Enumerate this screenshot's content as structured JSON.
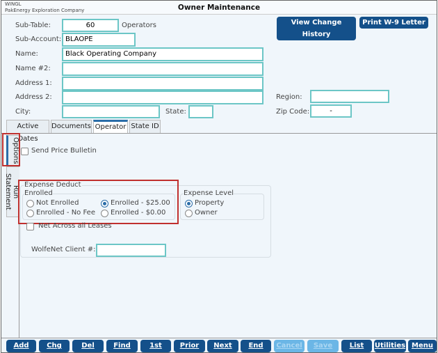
{
  "header": {
    "app": "WINGL",
    "company": "PakEnergy Exploration Company",
    "title": "Owner Maintenance"
  },
  "top_buttons": {
    "history": "View Change History",
    "w9": "Print W-9 Letter"
  },
  "form": {
    "sub_table_label": "Sub-Table:",
    "sub_table": "60",
    "sub_table_desc": "Operators",
    "sub_account_label": "Sub-Account:",
    "sub_account": "BLAOPE",
    "name_label": "Name:",
    "name": "Black Operating Company",
    "name2_label": "Name #2:",
    "name2": "",
    "address1_label": "Address 1:",
    "address1": "",
    "address2_label": "Address 2:",
    "address2": "",
    "city_label": "City:",
    "city": "",
    "state_label": "State:",
    "state": "",
    "region_label": "Region:",
    "region": "",
    "zip_label": "Zip Code:",
    "zip": "-"
  },
  "tabs": [
    "Active Dates",
    "Documents",
    "Operator",
    "State ID"
  ],
  "active_tab": "Operator",
  "side_tabs": [
    "Options",
    "Run Statement"
  ],
  "options": {
    "send_price_bulletin": {
      "label": "Send Price Bulletin",
      "checked": false
    },
    "expense_deduct_title": "Expense Deduct",
    "enrolled_title": "Enrolled",
    "enrolled_options": [
      "Not Enrolled",
      "Enrolled - $25.00",
      "Enrolled - No Fee",
      "Enrolled - $0.00"
    ],
    "enrolled_selected": "Enrolled - $25.00",
    "expense_level_title": "Expense Level",
    "expense_level_options": [
      "Property",
      "Owner"
    ],
    "expense_level_selected": "Property",
    "net_across": {
      "label": "Net Across all Leases",
      "checked": false
    },
    "wolfenet_label": "WolfeNet Client #:",
    "wolfenet": ""
  },
  "bottom_buttons": [
    "Add",
    "Chg",
    "Del",
    "Find",
    "1st",
    "Prior",
    "Next",
    "End",
    "Cancel",
    "Save",
    "List",
    "Utilities",
    "Menu"
  ],
  "disabled_buttons": [
    "Cancel",
    "Save"
  ],
  "colors": {
    "accent": "#14508a",
    "input_border": "#6cc6c6",
    "highlight": "#c0302e"
  }
}
